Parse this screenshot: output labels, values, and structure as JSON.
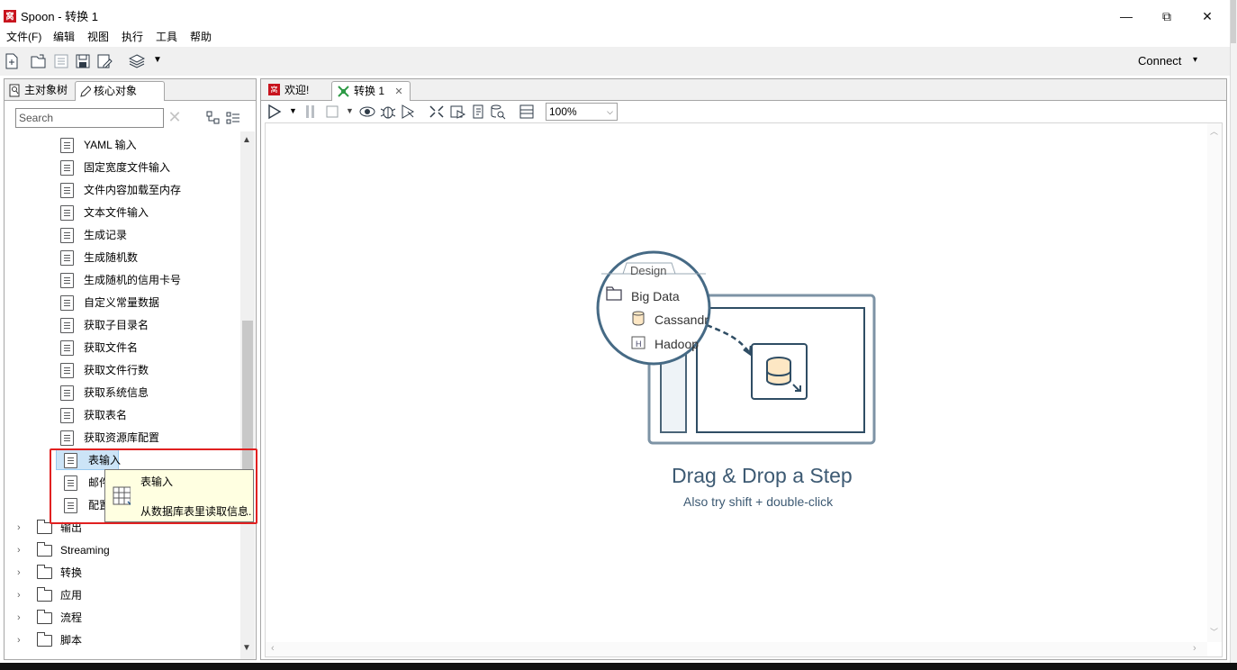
{
  "window": {
    "title": "Spoon - 转换 1",
    "logo": "窝",
    "controls": {
      "minimize": "—",
      "restore": "⧉",
      "close": "✕"
    }
  },
  "menu": [
    "文件(F)",
    "编辑",
    "视图",
    "执行",
    "工具",
    "帮助"
  ],
  "toolbar": {
    "icons": [
      "new-file-icon",
      "open-folder-icon",
      "explore-repository-icon",
      "save-icon",
      "save-as-icon",
      "layers-icon",
      "dropdown-caret-icon"
    ],
    "connect_label": "Connect",
    "connect_caret": "▾"
  },
  "left_panel": {
    "tabs": [
      {
        "label": "主对象树",
        "icon": "magnifier-tree-icon",
        "active": false
      },
      {
        "label": "核心对象",
        "icon": "pencil-icon",
        "active": true
      }
    ],
    "search_placeholder": "Search",
    "search_clear": "✕",
    "steps": [
      {
        "label": "YAML 输入",
        "icon": "yaml-input-icon"
      },
      {
        "label": "固定宽度文件输入",
        "icon": "fixed-width-file-input-icon"
      },
      {
        "label": "文件内容加载至内存",
        "icon": "load-file-content-icon"
      },
      {
        "label": "文本文件输入",
        "icon": "text-file-input-icon"
      },
      {
        "label": "生成记录",
        "icon": "generate-rows-icon"
      },
      {
        "label": "生成随机数",
        "icon": "generate-random-value-icon"
      },
      {
        "label": "生成随机的信用卡号",
        "icon": "generate-random-credit-card-icon"
      },
      {
        "label": "自定义常量数据",
        "icon": "data-grid-icon"
      },
      {
        "label": "获取子目录名",
        "icon": "get-subfolder-names-icon"
      },
      {
        "label": "获取文件名",
        "icon": "get-file-names-icon"
      },
      {
        "label": "获取文件行数",
        "icon": "get-file-row-count-icon"
      },
      {
        "label": "获取系统信息",
        "icon": "get-system-info-icon"
      },
      {
        "label": "获取表名",
        "icon": "get-table-names-icon"
      },
      {
        "label": "获取资源库配置",
        "icon": "get-repository-config-icon"
      },
      {
        "label": "表输入",
        "icon": "table-input-icon",
        "selected": true
      },
      {
        "label": "邮件",
        "icon": "email-messages-input-icon"
      },
      {
        "label": "配置",
        "icon": "config-file-input-icon"
      }
    ],
    "folders": [
      "输出",
      "Streaming",
      "转换",
      "应用",
      "流程",
      "脚本"
    ],
    "tooltip": {
      "title": "表输入",
      "description": "从数据库表里读取信息."
    }
  },
  "right_panel": {
    "tabs": [
      {
        "label": "欢迎!",
        "icon": "spoon-logo-icon",
        "active": false,
        "closable": false
      },
      {
        "label": "转换 1",
        "icon": "transformation-icon",
        "active": true,
        "closable": true
      }
    ],
    "canvas_toolbar": [
      "run-icon",
      "run-options-icon",
      "pause-icon",
      "stop-icon",
      "stop-options-icon",
      "preview-icon",
      "debug-icon",
      "replay-icon",
      "verify-icon",
      "impact-icon",
      "sql-icon",
      "explore-db-icon",
      "show-results-icon"
    ],
    "zoom": "100%",
    "drop_hint": {
      "title": "Drag & Drop a Step",
      "subtitle": "Also try shift + double-click",
      "illustration": {
        "tab_label": "Design",
        "folder_label": "Big Data",
        "items": [
          "Cassandr",
          "Hadoop"
        ]
      }
    }
  },
  "colors": {
    "accent_red": "#e12020",
    "hint_blue": "#3d5a73",
    "tooltip_bg": "#ffffe1",
    "selection": "#cce4f7"
  }
}
